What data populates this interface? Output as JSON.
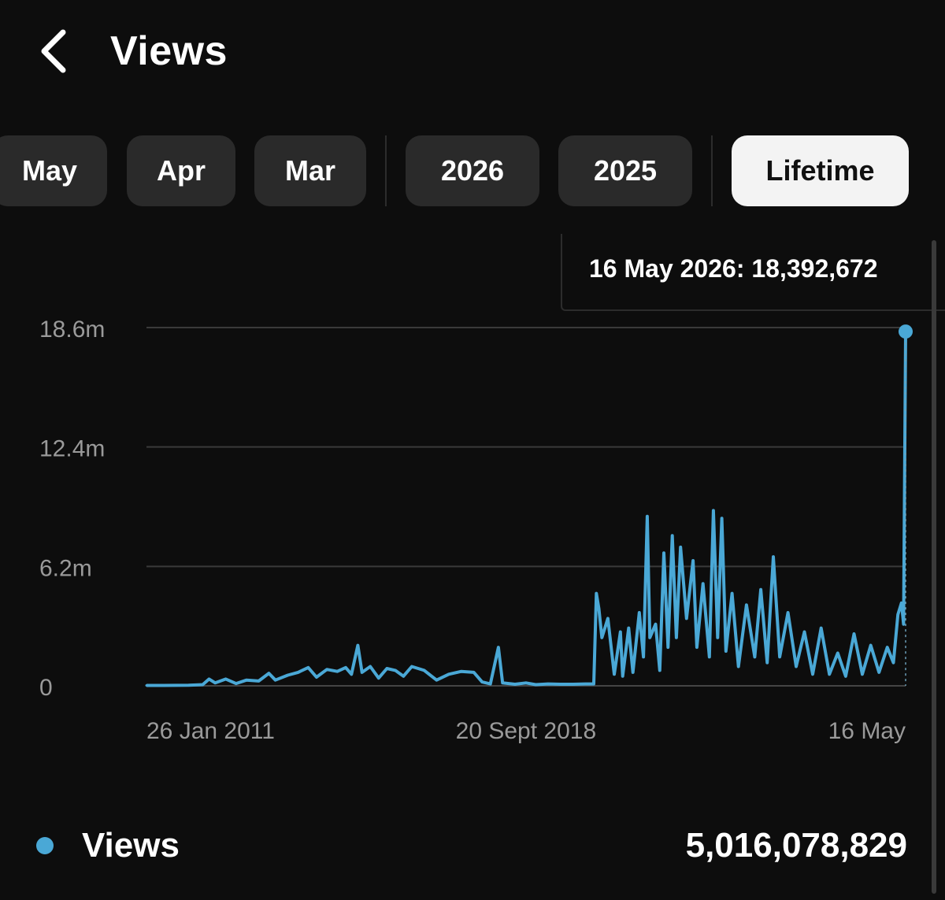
{
  "header": {
    "title": "Views",
    "back_icon": "chevron-left-icon"
  },
  "tabs": [
    {
      "label": "May",
      "active": false
    },
    {
      "label": "Apr",
      "active": false
    },
    {
      "label": "Mar",
      "active": false
    },
    {
      "label": "2026",
      "active": false
    },
    {
      "label": "2025",
      "active": false
    },
    {
      "label": "Lifetime",
      "active": true
    }
  ],
  "tooltip": {
    "text": "16 May 2026: 18,392,672"
  },
  "legend": {
    "label": "Views",
    "total": "5,016,078,829",
    "color": "#4aa8d6"
  },
  "colors": {
    "background": "#0d0d0d",
    "series": "#4aa8d6",
    "grid": "#3a3a3a",
    "tab_bg": "#2a2a2a",
    "tab_active_bg": "#f3f3f3"
  },
  "chart_data": {
    "type": "line",
    "title": "",
    "xlabel": "",
    "ylabel": "",
    "x_range": [
      "26 Jan 2011",
      "16 May 2026"
    ],
    "ylim": [
      0,
      18600000
    ],
    "y_ticks": [
      {
        "value": 0,
        "label": "0"
      },
      {
        "value": 6200000,
        "label": "6.2m"
      },
      {
        "value": 12400000,
        "label": "12.4m"
      },
      {
        "value": 18600000,
        "label": "18.6m"
      }
    ],
    "x_ticks": [
      {
        "date": "2011-01-26",
        "label": "26 Jan 2011"
      },
      {
        "date": "2018-09-20",
        "label": "20 Sept 2018"
      },
      {
        "date": "2026-05-16",
        "label": "16 May"
      }
    ],
    "grid": true,
    "highlight": {
      "date": "2026-05-16",
      "value": 18392672
    },
    "series": [
      {
        "name": "Views",
        "color": "#4aa8d6",
        "points": [
          [
            "2011-01-26",
            20000
          ],
          [
            "2011-06-01",
            20000
          ],
          [
            "2011-12-01",
            30000
          ],
          [
            "2012-03-15",
            60000
          ],
          [
            "2012-05-01",
            350000
          ],
          [
            "2012-06-15",
            150000
          ],
          [
            "2012-09-01",
            350000
          ],
          [
            "2012-11-15",
            120000
          ],
          [
            "2013-02-01",
            300000
          ],
          [
            "2013-05-01",
            250000
          ],
          [
            "2013-07-15",
            650000
          ],
          [
            "2013-09-01",
            300000
          ],
          [
            "2013-12-01",
            550000
          ],
          [
            "2014-02-15",
            700000
          ],
          [
            "2014-05-01",
            950000
          ],
          [
            "2014-07-01",
            450000
          ],
          [
            "2014-09-15",
            850000
          ],
          [
            "2014-12-01",
            750000
          ],
          [
            "2015-02-01",
            950000
          ],
          [
            "2015-03-15",
            600000
          ],
          [
            "2015-05-01",
            2100000
          ],
          [
            "2015-06-01",
            700000
          ],
          [
            "2015-08-01",
            1000000
          ],
          [
            "2015-10-01",
            400000
          ],
          [
            "2015-12-01",
            900000
          ],
          [
            "2016-02-01",
            800000
          ],
          [
            "2016-04-01",
            500000
          ],
          [
            "2016-06-01",
            1000000
          ],
          [
            "2016-09-01",
            800000
          ],
          [
            "2016-12-01",
            300000
          ],
          [
            "2017-03-01",
            600000
          ],
          [
            "2017-06-01",
            750000
          ],
          [
            "2017-09-01",
            700000
          ],
          [
            "2017-11-01",
            200000
          ],
          [
            "2018-01-01",
            100000
          ],
          [
            "2018-03-01",
            2000000
          ],
          [
            "2018-04-01",
            150000
          ],
          [
            "2018-07-01",
            80000
          ],
          [
            "2018-09-20",
            150000
          ],
          [
            "2018-12-01",
            60000
          ],
          [
            "2019-03-01",
            100000
          ],
          [
            "2019-06-01",
            80000
          ],
          [
            "2019-09-01",
            80000
          ],
          [
            "2019-12-01",
            100000
          ],
          [
            "2020-02-01",
            100000
          ],
          [
            "2020-02-20",
            4800000
          ],
          [
            "2020-03-10",
            4000000
          ],
          [
            "2020-04-01",
            2500000
          ],
          [
            "2020-05-15",
            3500000
          ],
          [
            "2020-07-01",
            600000
          ],
          [
            "2020-08-15",
            2800000
          ],
          [
            "2020-09-01",
            500000
          ],
          [
            "2020-10-15",
            3000000
          ],
          [
            "2020-11-15",
            700000
          ],
          [
            "2021-01-01",
            3800000
          ],
          [
            "2021-02-01",
            1500000
          ],
          [
            "2021-03-01",
            8800000
          ],
          [
            "2021-03-20",
            2500000
          ],
          [
            "2021-05-01",
            3200000
          ],
          [
            "2021-06-01",
            800000
          ],
          [
            "2021-07-01",
            6900000
          ],
          [
            "2021-08-01",
            2000000
          ],
          [
            "2021-09-01",
            7800000
          ],
          [
            "2021-10-01",
            2500000
          ],
          [
            "2021-11-01",
            7200000
          ],
          [
            "2021-12-15",
            3500000
          ],
          [
            "2022-02-01",
            6500000
          ],
          [
            "2022-03-01",
            2000000
          ],
          [
            "2022-04-15",
            5300000
          ],
          [
            "2022-06-01",
            1500000
          ],
          [
            "2022-07-01",
            9100000
          ],
          [
            "2022-08-01",
            2500000
          ],
          [
            "2022-09-01",
            8700000
          ],
          [
            "2022-10-01",
            1800000
          ],
          [
            "2022-11-15",
            4800000
          ],
          [
            "2023-01-01",
            1000000
          ],
          [
            "2023-03-01",
            4200000
          ],
          [
            "2023-05-01",
            1500000
          ],
          [
            "2023-06-15",
            5000000
          ],
          [
            "2023-08-01",
            1200000
          ],
          [
            "2023-09-15",
            6700000
          ],
          [
            "2023-11-01",
            1500000
          ],
          [
            "2024-01-01",
            3800000
          ],
          [
            "2024-03-01",
            1000000
          ],
          [
            "2024-05-01",
            2800000
          ],
          [
            "2024-07-01",
            600000
          ],
          [
            "2024-09-01",
            3000000
          ],
          [
            "2024-11-01",
            600000
          ],
          [
            "2025-01-01",
            1700000
          ],
          [
            "2025-03-01",
            500000
          ],
          [
            "2025-05-01",
            2700000
          ],
          [
            "2025-07-01",
            600000
          ],
          [
            "2025-09-01",
            2100000
          ],
          [
            "2025-11-01",
            700000
          ],
          [
            "2026-01-01",
            2000000
          ],
          [
            "2026-02-15",
            1200000
          ],
          [
            "2026-03-20",
            3700000
          ],
          [
            "2026-04-15",
            4300000
          ],
          [
            "2026-05-01",
            3200000
          ],
          [
            "2026-05-16",
            18392672
          ]
        ]
      }
    ]
  }
}
